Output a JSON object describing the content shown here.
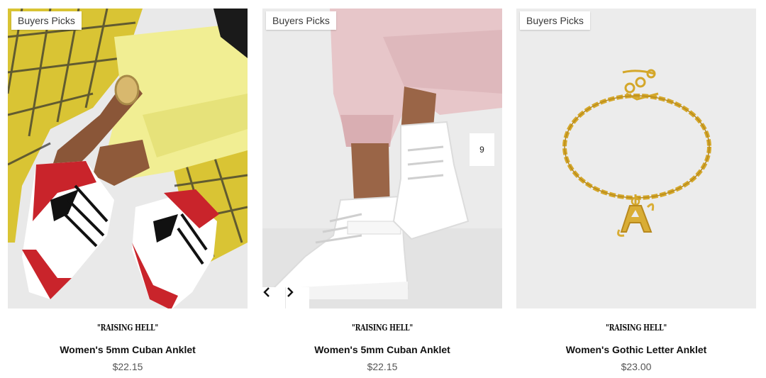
{
  "products": [
    {
      "badge": "Buyers Picks",
      "brand": "\"RAISING HELL\"",
      "title": "Women's 5mm Cuban Anklet",
      "price": "$22.15",
      "image_icon": "sneakers-plaid-outfit-photo"
    },
    {
      "badge": "Buyers Picks",
      "brand": "\"RAISING HELL\"",
      "title": "Women's 5mm Cuban Anklet",
      "price": "$22.15",
      "image_icon": "white-high-top-sneakers-photo"
    },
    {
      "badge": "Buyers Picks",
      "brand": "\"RAISING HELL\"",
      "title": "Women's Gothic Letter Anklet",
      "price": "$23.00",
      "image_icon": "gold-letter-anklet-photo"
    }
  ],
  "carousel": {
    "counter": "9",
    "prev_icon": "chevron-left-icon",
    "next_icon": "chevron-right-icon"
  },
  "colors": {
    "badge_bg": "#ffffff",
    "title": "#111111",
    "price": "#555555",
    "image_bg": "#ececec"
  }
}
